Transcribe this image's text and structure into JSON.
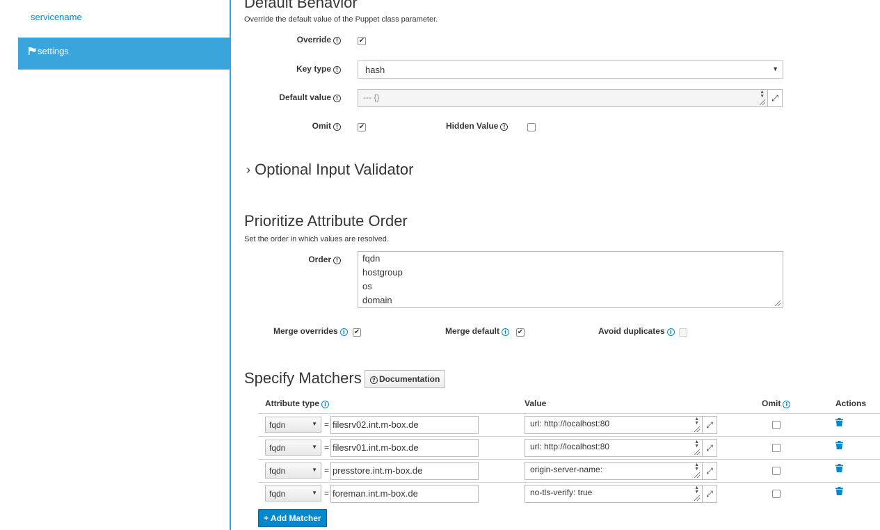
{
  "sidebar": {
    "link": "servicename",
    "active_item": "settings"
  },
  "default_behavior": {
    "title": "Default Behavior",
    "help": "Override the default value of the Puppet class parameter.",
    "override_label": "Override",
    "override_checked": true,
    "key_type_label": "Key type",
    "key_type_value": "hash",
    "default_value_label": "Default value",
    "default_value": "--- {}",
    "omit_label": "Omit",
    "omit_checked": true,
    "hidden_value_label": "Hidden Value",
    "hidden_value_checked": false
  },
  "validator": {
    "title": "Optional Input Validator"
  },
  "prioritize": {
    "title": "Prioritize Attribute Order",
    "help": "Set the order in which values are resolved.",
    "order_label": "Order",
    "order": [
      "fqdn",
      "hostgroup",
      "os",
      "domain"
    ],
    "merge_overrides_label": "Merge overrides",
    "merge_overrides_checked": true,
    "merge_default_label": "Merge default",
    "merge_default_checked": true,
    "avoid_duplicates_label": "Avoid duplicates",
    "avoid_duplicates_checked": false
  },
  "matchers": {
    "title": "Specify Matchers",
    "doc_button": "Documentation",
    "headers": {
      "attribute_type": "Attribute type",
      "value": "Value",
      "omit": "Omit",
      "actions": "Actions"
    },
    "rows": [
      {
        "type": "fqdn",
        "eq": "=",
        "match": "filesrv02.int.m-box.de",
        "value": "url: http://localhost:80",
        "omit": false
      },
      {
        "type": "fqdn",
        "eq": "=",
        "match": "filesrv01.int.m-box.de",
        "value": "url: http://localhost:80",
        "omit": false
      },
      {
        "type": "fqdn",
        "eq": "=",
        "match": "presstore.int.m-box.de",
        "value": "origin-server-name:",
        "omit": false
      },
      {
        "type": "fqdn",
        "eq": "=",
        "match": "foreman.int.m-box.de",
        "value": "no-tls-verify: true",
        "omit": false
      }
    ],
    "add_button": "+ Add Matcher"
  },
  "colors": {
    "accent": "#39a5dc",
    "link": "#0088ce",
    "primary_button": "#0088ce"
  }
}
